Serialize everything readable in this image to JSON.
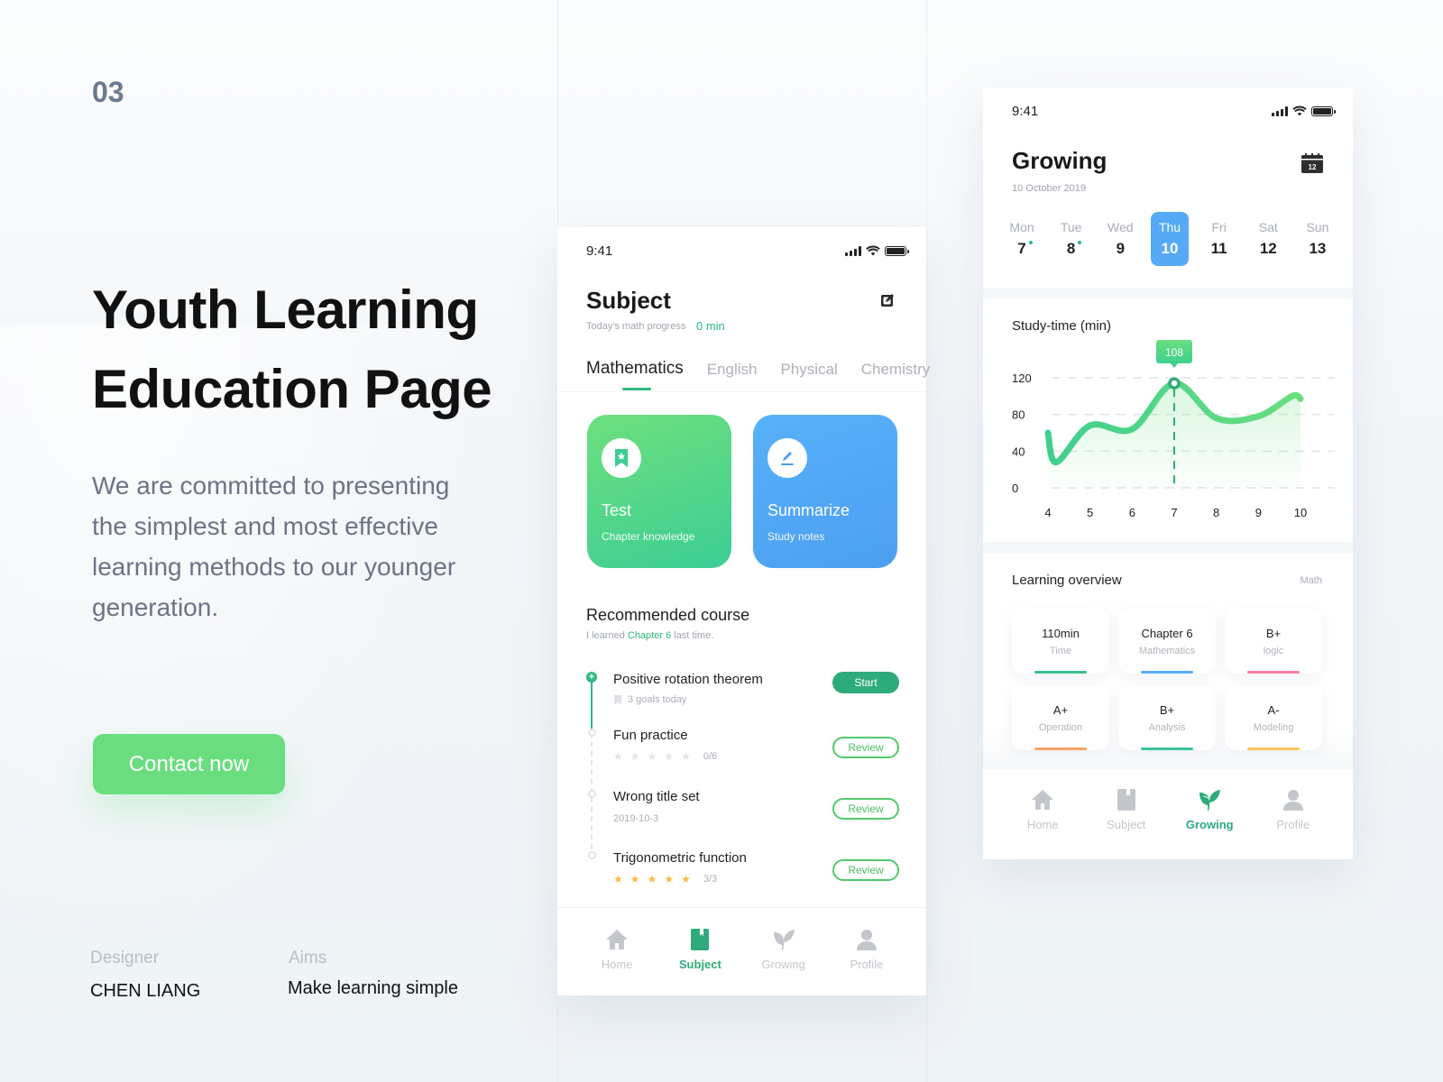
{
  "intro": {
    "number": "03",
    "title_line1": "Youth Learning",
    "title_line2": "Education Page",
    "description": "We are committed to presenting the simplest and most effective learning methods to our younger generation.",
    "contact_button": "Contact now",
    "designer_label": "Designer",
    "designer_value": "CHEN LIANG",
    "aims_label": "Aims",
    "aims_value": "Make learning simple"
  },
  "subject_screen": {
    "status_time": "9:41",
    "title": "Subject",
    "progress_label": "Today's math progress",
    "progress_value": "0 min",
    "tabs": [
      {
        "label": "Mathematics",
        "active": true
      },
      {
        "label": "English",
        "active": false
      },
      {
        "label": "Physical",
        "active": false
      },
      {
        "label": "Chemistry",
        "active": false
      }
    ],
    "cards": [
      {
        "title": "Test",
        "subtitle": "Chapter knowledge",
        "icon": "bookmark-star-icon"
      },
      {
        "title": "Summarize",
        "subtitle": "Study notes",
        "icon": "pencil-icon"
      }
    ],
    "recommended": {
      "title": "Recommended course",
      "sub_prefix": "I learned",
      "sub_highlight": "Chapter 6",
      "sub_suffix": "last time.",
      "courses": [
        {
          "name": "Positive rotation theorem",
          "meta": "3 goals today",
          "meta_icon": "bookmark-icon",
          "action": "Start"
        },
        {
          "name": "Fun practice",
          "stars_filled": 0,
          "stars_total": 5,
          "meta": "0/6",
          "action": "Review"
        },
        {
          "name": "Wrong title set",
          "meta": "2019-10-3",
          "action": "Review"
        },
        {
          "name": "Trigonometric function",
          "stars_filled": 5,
          "stars_total": 5,
          "meta": "3/3",
          "action": "Review"
        }
      ]
    },
    "tabbar": [
      {
        "label": "Home",
        "icon": "home-icon",
        "active": false
      },
      {
        "label": "Subject",
        "icon": "book-icon",
        "active": true
      },
      {
        "label": "Growing",
        "icon": "leaf-icon",
        "active": false
      },
      {
        "label": "Profile",
        "icon": "user-icon",
        "active": false
      }
    ]
  },
  "growing_screen": {
    "status_time": "9:41",
    "title": "Growing",
    "date": "10 October 2019",
    "calendar_icon_number": "12",
    "week": [
      {
        "day": "Mon",
        "date": "7",
        "mark": true,
        "active": false
      },
      {
        "day": "Tue",
        "date": "8",
        "mark": true,
        "active": false
      },
      {
        "day": "Wed",
        "date": "9",
        "mark": false,
        "active": false
      },
      {
        "day": "Thu",
        "date": "10",
        "mark": false,
        "active": true
      },
      {
        "day": "Fri",
        "date": "11",
        "mark": false,
        "active": false
      },
      {
        "day": "Sat",
        "date": "12",
        "mark": false,
        "active": false
      },
      {
        "day": "Sun",
        "date": "13",
        "mark": false,
        "active": false
      }
    ],
    "overview": {
      "title": "Learning overview",
      "tag": "Math",
      "items": [
        {
          "value": "110min",
          "label": "Time",
          "color": "#3cc08a"
        },
        {
          "value": "Chapter 6",
          "label": "Mathematics",
          "color": "#58aef8"
        },
        {
          "value": "B+",
          "label": "logic",
          "color": "#f77fa0"
        },
        {
          "value": "A+",
          "label": "Operation",
          "color": "#fba36b"
        },
        {
          "value": "B+",
          "label": "Analysis",
          "color": "#3cc4a0"
        },
        {
          "value": "A-",
          "label": "Modeling",
          "color": "#fbc35e"
        }
      ]
    },
    "tabbar": [
      {
        "label": "Home",
        "icon": "home-icon",
        "active": false
      },
      {
        "label": "Subject",
        "icon": "book-icon",
        "active": false
      },
      {
        "label": "Growing",
        "icon": "leaf-icon",
        "active": true
      },
      {
        "label": "Profile",
        "icon": "user-icon",
        "active": false
      }
    ]
  },
  "chart_data": {
    "type": "line",
    "title": "Study-time (min)",
    "xlabel": "",
    "ylabel": "",
    "x": [
      4,
      4.2,
      5,
      6,
      7,
      8,
      9,
      9.8,
      10
    ],
    "values": [
      60,
      28,
      68,
      64,
      114,
      76,
      78,
      100,
      97
    ],
    "x_ticks": [
      "4",
      "5",
      "6",
      "7",
      "8",
      "9",
      "10"
    ],
    "y_ticks": [
      "0",
      "40",
      "80",
      "120"
    ],
    "xlim": [
      4,
      10
    ],
    "ylim": [
      0,
      120
    ],
    "grid": "horizontal-dashed",
    "highlight": {
      "x": 7,
      "label": "108"
    },
    "series_color": "#5fd98a"
  }
}
